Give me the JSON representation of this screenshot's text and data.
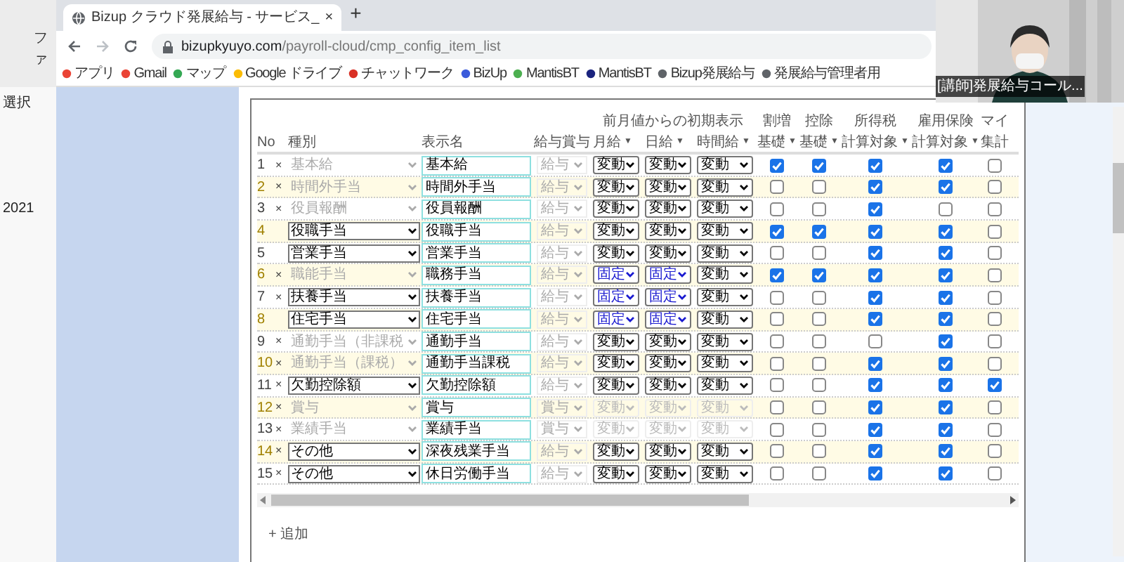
{
  "behind_window": {
    "texts": [
      "ファ",
      "選択",
      "2021"
    ]
  },
  "browser": {
    "tab": {
      "title": "Bizup クラウド発展給与 - サービス_",
      "close": "×"
    },
    "new_tab": "+",
    "url": {
      "host": "bizupkyuyo.com",
      "path": "/payroll-cloud/cmp_config_item_list"
    },
    "bookmarks": [
      {
        "label": "アプリ"
      },
      {
        "label": "Gmail"
      },
      {
        "label": "マップ"
      },
      {
        "label": "Google ドライブ"
      },
      {
        "label": "チャットワーク"
      },
      {
        "label": "BizUp"
      },
      {
        "label": "MantisBT"
      },
      {
        "label": "MantisBT"
      },
      {
        "label": "Bizup発展給与"
      },
      {
        "label": "発展給与管理者用"
      }
    ]
  },
  "table": {
    "group_header": "前月値からの初期表示",
    "columns": [
      {
        "label": "No"
      },
      {
        "label": "種別"
      },
      {
        "label": "表示名"
      },
      {
        "label": "給与賞与"
      },
      {
        "label": "月給",
        "sort": "▼"
      },
      {
        "label": "日給",
        "sort": "▼"
      },
      {
        "label": "時間給",
        "sort": "▼"
      },
      {
        "top": "割増",
        "label": "基礎",
        "sort": "▼"
      },
      {
        "top": "控除",
        "label": "基礎",
        "sort": "▼"
      },
      {
        "top": "所得税",
        "label": "計算対象",
        "sort": "▼"
      },
      {
        "top": "雇用保険",
        "label": "計算対象",
        "sort": "▼"
      },
      {
        "top": "マイ",
        "label": "集計"
      }
    ],
    "rows": [
      {
        "no": "1",
        "delete": "×",
        "type": {
          "value": "基本給",
          "disabled": true
        },
        "name": "基本給",
        "pay": {
          "value": "給与",
          "disabled": true
        },
        "initial": [
          {
            "value": "変動",
            "disabled": false,
            "fixed": false
          },
          {
            "value": "変動",
            "disabled": false,
            "fixed": false
          },
          {
            "value": "変動",
            "disabled": false,
            "fixed": false
          }
        ],
        "flags": [
          true,
          true,
          true,
          true,
          false
        ]
      },
      {
        "no": "2",
        "delete": "×",
        "type": {
          "value": "時間外手当",
          "disabled": true
        },
        "name": "時間外手当",
        "pay": {
          "value": "給与",
          "disabled": true
        },
        "initial": [
          {
            "value": "変動",
            "disabled": false,
            "fixed": false
          },
          {
            "value": "変動",
            "disabled": false,
            "fixed": false
          },
          {
            "value": "変動",
            "disabled": false,
            "fixed": false
          }
        ],
        "flags": [
          false,
          false,
          true,
          true,
          false
        ]
      },
      {
        "no": "3",
        "delete": "×",
        "type": {
          "value": "役員報酬",
          "disabled": true
        },
        "name": "役員報酬",
        "pay": {
          "value": "給与",
          "disabled": true
        },
        "initial": [
          {
            "value": "変動",
            "disabled": false,
            "fixed": false
          },
          {
            "value": "変動",
            "disabled": false,
            "fixed": false
          },
          {
            "value": "変動",
            "disabled": false,
            "fixed": false
          }
        ],
        "flags": [
          false,
          false,
          true,
          false,
          false
        ]
      },
      {
        "no": "4",
        "type": {
          "value": "役職手当",
          "disabled": false
        },
        "name": "役職手当",
        "pay": {
          "value": "給与",
          "disabled": true
        },
        "initial": [
          {
            "value": "変動",
            "disabled": false,
            "fixed": false
          },
          {
            "value": "変動",
            "disabled": false,
            "fixed": false
          },
          {
            "value": "変動",
            "disabled": false,
            "fixed": false
          }
        ],
        "flags": [
          true,
          true,
          true,
          true,
          false
        ]
      },
      {
        "no": "5",
        "type": {
          "value": "営業手当",
          "disabled": false
        },
        "name": "営業手当",
        "pay": {
          "value": "給与",
          "disabled": true
        },
        "initial": [
          {
            "value": "変動",
            "disabled": false,
            "fixed": false
          },
          {
            "value": "変動",
            "disabled": false,
            "fixed": false
          },
          {
            "value": "変動",
            "disabled": false,
            "fixed": false
          }
        ],
        "flags": [
          false,
          false,
          true,
          true,
          false
        ]
      },
      {
        "no": "6",
        "delete": "×",
        "type": {
          "value": "職能手当",
          "disabled": true
        },
        "name": "職務手当",
        "pay": {
          "value": "給与",
          "disabled": true
        },
        "initial": [
          {
            "value": "固定",
            "disabled": false,
            "fixed": true
          },
          {
            "value": "固定",
            "disabled": false,
            "fixed": true
          },
          {
            "value": "変動",
            "disabled": false,
            "fixed": false
          }
        ],
        "flags": [
          true,
          true,
          true,
          true,
          false
        ]
      },
      {
        "no": "7",
        "delete": "×",
        "type": {
          "value": "扶養手当",
          "disabled": false
        },
        "name": "扶養手当",
        "pay": {
          "value": "給与",
          "disabled": true
        },
        "initial": [
          {
            "value": "固定",
            "disabled": false,
            "fixed": true
          },
          {
            "value": "固定",
            "disabled": false,
            "fixed": true
          },
          {
            "value": "変動",
            "disabled": false,
            "fixed": false
          }
        ],
        "flags": [
          false,
          false,
          true,
          true,
          false
        ]
      },
      {
        "no": "8",
        "type": {
          "value": "住宅手当",
          "disabled": false
        },
        "name": "住宅手当",
        "pay": {
          "value": "給与",
          "disabled": true
        },
        "initial": [
          {
            "value": "固定",
            "disabled": false,
            "fixed": true
          },
          {
            "value": "固定",
            "disabled": false,
            "fixed": true
          },
          {
            "value": "変動",
            "disabled": false,
            "fixed": false
          }
        ],
        "flags": [
          false,
          false,
          true,
          true,
          false
        ]
      },
      {
        "no": "9",
        "delete": "×",
        "type": {
          "value": "通勤手当（非課税",
          "disabled": true
        },
        "name": "通勤手当",
        "pay": {
          "value": "給与",
          "disabled": true
        },
        "initial": [
          {
            "value": "変動",
            "disabled": false,
            "fixed": false
          },
          {
            "value": "変動",
            "disabled": false,
            "fixed": false
          },
          {
            "value": "変動",
            "disabled": false,
            "fixed": false
          }
        ],
        "flags": [
          false,
          false,
          false,
          true,
          false
        ]
      },
      {
        "no": "10",
        "delete": "×",
        "type": {
          "value": "通勤手当（課税）",
          "disabled": true
        },
        "name": "通勤手当課税",
        "pay": {
          "value": "給与",
          "disabled": true
        },
        "initial": [
          {
            "value": "変動",
            "disabled": false,
            "fixed": false
          },
          {
            "value": "変動",
            "disabled": false,
            "fixed": false
          },
          {
            "value": "変動",
            "disabled": false,
            "fixed": false
          }
        ],
        "flags": [
          false,
          false,
          true,
          true,
          false
        ]
      },
      {
        "no": "11",
        "delete": "×",
        "type": {
          "value": "欠勤控除額",
          "disabled": false
        },
        "name": "欠勤控除額",
        "pay": {
          "value": "給与",
          "disabled": true
        },
        "initial": [
          {
            "value": "変動",
            "disabled": false,
            "fixed": false
          },
          {
            "value": "変動",
            "disabled": false,
            "fixed": false
          },
          {
            "value": "変動",
            "disabled": false,
            "fixed": false
          }
        ],
        "flags": [
          false,
          false,
          true,
          true,
          true
        ]
      },
      {
        "no": "12",
        "delete": "×",
        "type": {
          "value": "賞与",
          "disabled": true
        },
        "name": "賞与",
        "pay": {
          "value": "賞与",
          "disabled": true
        },
        "initial": [
          {
            "value": "変動",
            "disabled": true,
            "fixed": false
          },
          {
            "value": "変動",
            "disabled": true,
            "fixed": false
          },
          {
            "value": "変動",
            "disabled": true,
            "fixed": false
          }
        ],
        "flags": [
          false,
          false,
          true,
          true,
          false
        ]
      },
      {
        "no": "13",
        "delete": "×",
        "type": {
          "value": "業績手当",
          "disabled": true
        },
        "name": "業績手当",
        "pay": {
          "value": "賞与",
          "disabled": true
        },
        "initial": [
          {
            "value": "変動",
            "disabled": true,
            "fixed": false
          },
          {
            "value": "変動",
            "disabled": true,
            "fixed": false
          },
          {
            "value": "変動",
            "disabled": true,
            "fixed": false
          }
        ],
        "flags": [
          false,
          false,
          true,
          true,
          false
        ]
      },
      {
        "no": "14",
        "delete": "×",
        "type": {
          "value": "その他",
          "disabled": false
        },
        "name": "深夜残業手当",
        "pay": {
          "value": "給与",
          "disabled": true
        },
        "initial": [
          {
            "value": "変動",
            "disabled": false,
            "fixed": false
          },
          {
            "value": "変動",
            "disabled": false,
            "fixed": false
          },
          {
            "value": "変動",
            "disabled": false,
            "fixed": false
          }
        ],
        "flags": [
          false,
          false,
          true,
          true,
          false
        ]
      },
      {
        "no": "15",
        "delete": "×",
        "type": {
          "value": "その他",
          "disabled": false
        },
        "name": "休日労働手当",
        "pay": {
          "value": "給与",
          "disabled": true
        },
        "initial": [
          {
            "value": "変動",
            "disabled": false,
            "fixed": false
          },
          {
            "value": "変動",
            "disabled": false,
            "fixed": false
          },
          {
            "value": "変動",
            "disabled": false,
            "fixed": false
          }
        ],
        "flags": [
          false,
          false,
          true,
          true,
          false
        ]
      }
    ]
  },
  "add_link": "+ 追加",
  "video": {
    "caption": "[講師]発展給与コール..."
  }
}
